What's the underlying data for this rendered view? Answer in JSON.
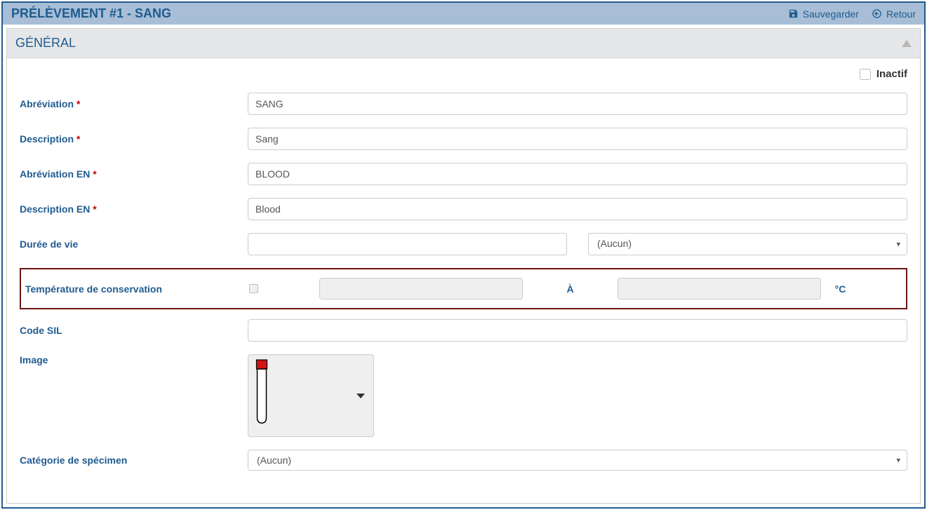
{
  "header": {
    "title": "PRÉLÈVEMENT #1 - SANG",
    "save_label": "Sauvegarder",
    "return_label": "Retour"
  },
  "section_title": "GÉNÉRAL",
  "inactive_label": "Inactif",
  "fields": {
    "abbreviation_label": "Abréviation",
    "abbreviation_value": "SANG",
    "description_label": "Description",
    "description_value": "Sang",
    "abbreviation_en_label": "Abréviation EN",
    "abbreviation_en_value": "BLOOD",
    "description_en_label": "Description EN",
    "description_en_value": "Blood",
    "duree_label": "Durée de vie",
    "duree_value": "",
    "duree_unit": "(Aucun)",
    "temp_label": "Température de conservation",
    "temp_sep": "À",
    "temp_unit": "°C",
    "code_sil_label": "Code SIL",
    "code_sil_value": "",
    "image_label": "Image",
    "categ_label": "Catégorie de spécimen",
    "categ_value": "(Aucun)"
  },
  "required_marker": " *"
}
